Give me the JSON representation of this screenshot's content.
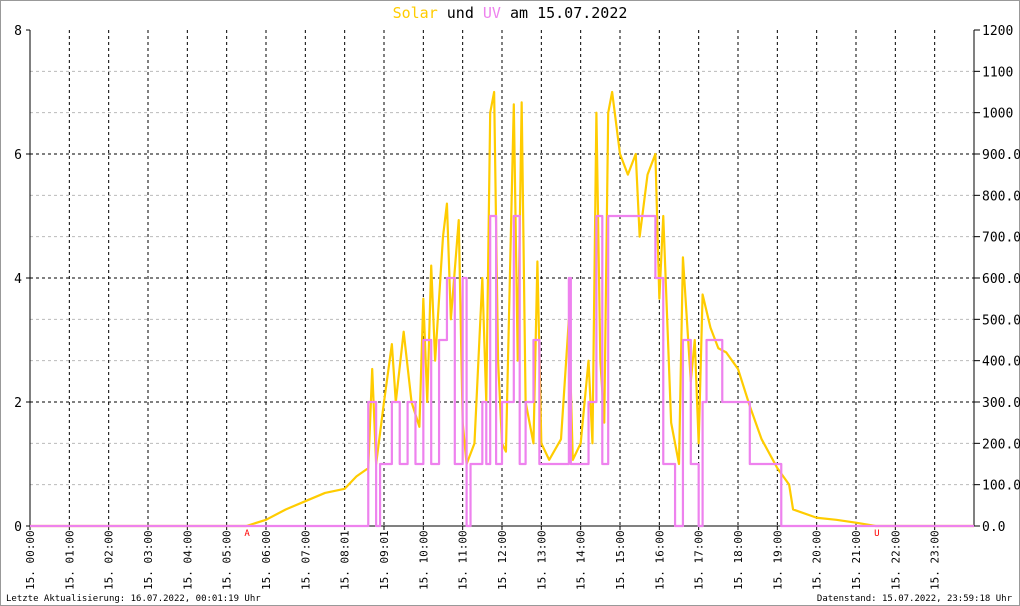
{
  "title": {
    "part1": "Solar",
    "part2": " und ",
    "part3": "UV",
    "part4": " am 15.07.2022"
  },
  "footer": {
    "left": "Letzte Aktualisierung: 16.07.2022, 00:01:19 Uhr",
    "right": "Datenstand: 15.07.2022, 23:59:18 Uhr"
  },
  "colors": {
    "solar": "#ffcc00",
    "uv": "#ee82ee",
    "marker": "#ff0000"
  },
  "chart_data": {
    "type": "line",
    "title": "Solar und UV am 15.07.2022",
    "x_tick_labels": [
      "15. 00:00",
      "15. 01:00",
      "15. 02:00",
      "15. 03:00",
      "15. 04:00",
      "15. 05:00",
      "15. 06:00",
      "15. 07:00",
      "15. 08:01",
      "15. 09:01",
      "15. 10:00",
      "15. 11:00",
      "15. 12:00",
      "15. 13:00",
      "15. 14:00",
      "15. 15:00",
      "15. 16:00",
      "15. 17:00",
      "15. 18:00",
      "15. 19:00",
      "15. 20:00",
      "15. 21:00",
      "15. 22:00",
      "15. 23:00"
    ],
    "xlim": [
      0,
      24
    ],
    "y_left": {
      "ylim": [
        0,
        8
      ],
      "ticks": [
        "0",
        "2",
        "4",
        "6",
        "8"
      ]
    },
    "y_right": {
      "ylim": [
        0,
        1200
      ],
      "ticks": [
        "0.0",
        "100.0",
        "200.0",
        "300.0",
        "400.0",
        "500.0",
        "600.0",
        "700.0",
        "800.0",
        "900.0",
        "1000",
        "1100",
        "1200"
      ]
    },
    "markers": [
      {
        "label": "A",
        "x": 5.52
      },
      {
        "label": "U",
        "x": 21.53
      }
    ],
    "series": [
      {
        "name": "Solar",
        "axis": "right",
        "points": [
          [
            0,
            0
          ],
          [
            5.5,
            0
          ],
          [
            6,
            15
          ],
          [
            6.5,
            40
          ],
          [
            7,
            60
          ],
          [
            7.5,
            80
          ],
          [
            8,
            90
          ],
          [
            8.3,
            120
          ],
          [
            8.6,
            140
          ],
          [
            8.7,
            380
          ],
          [
            8.8,
            150
          ],
          [
            9,
            300
          ],
          [
            9.2,
            440
          ],
          [
            9.3,
            300
          ],
          [
            9.5,
            470
          ],
          [
            9.7,
            300
          ],
          [
            9.9,
            240
          ],
          [
            10,
            550
          ],
          [
            10.1,
            300
          ],
          [
            10.2,
            630
          ],
          [
            10.3,
            400
          ],
          [
            10.5,
            700
          ],
          [
            10.6,
            780
          ],
          [
            10.7,
            500
          ],
          [
            10.9,
            740
          ],
          [
            11,
            250
          ],
          [
            11.1,
            150
          ],
          [
            11.3,
            200
          ],
          [
            11.5,
            600
          ],
          [
            11.6,
            300
          ],
          [
            11.7,
            1000
          ],
          [
            11.8,
            1050
          ],
          [
            11.9,
            400
          ],
          [
            12,
            200
          ],
          [
            12.1,
            180
          ],
          [
            12.3,
            1020
          ],
          [
            12.4,
            400
          ],
          [
            12.5,
            1025
          ],
          [
            12.6,
            300
          ],
          [
            12.8,
            200
          ],
          [
            12.9,
            640
          ],
          [
            13,
            200
          ],
          [
            13.2,
            160
          ],
          [
            13.5,
            210
          ],
          [
            13.7,
            500
          ],
          [
            13.8,
            160
          ],
          [
            14,
            200
          ],
          [
            14.2,
            400
          ],
          [
            14.3,
            200
          ],
          [
            14.4,
            1000
          ],
          [
            14.5,
            400
          ],
          [
            14.6,
            250
          ],
          [
            14.7,
            1000
          ],
          [
            14.8,
            1050
          ],
          [
            15,
            900
          ],
          [
            15.2,
            850
          ],
          [
            15.4,
            900
          ],
          [
            15.5,
            700
          ],
          [
            15.7,
            850
          ],
          [
            15.9,
            900
          ],
          [
            16,
            550
          ],
          [
            16.1,
            750
          ],
          [
            16.3,
            250
          ],
          [
            16.5,
            150
          ],
          [
            16.6,
            650
          ],
          [
            16.8,
            350
          ],
          [
            16.9,
            450
          ],
          [
            17,
            200
          ],
          [
            17.1,
            560
          ],
          [
            17.3,
            480
          ],
          [
            17.5,
            430
          ],
          [
            17.7,
            420
          ],
          [
            18,
            380
          ],
          [
            18.3,
            290
          ],
          [
            18.6,
            210
          ],
          [
            19,
            140
          ],
          [
            19.3,
            100
          ],
          [
            19.4,
            40
          ],
          [
            20,
            20
          ],
          [
            20.5,
            15
          ],
          [
            21,
            8
          ],
          [
            21.5,
            0
          ],
          [
            24,
            0
          ]
        ]
      },
      {
        "name": "UV",
        "axis": "left",
        "step": true,
        "points": [
          [
            0,
            0
          ],
          [
            8.6,
            2
          ],
          [
            8.8,
            0
          ],
          [
            8.9,
            1
          ],
          [
            9.2,
            2
          ],
          [
            9.4,
            1
          ],
          [
            9.6,
            2
          ],
          [
            9.8,
            1
          ],
          [
            10,
            3
          ],
          [
            10.2,
            1
          ],
          [
            10.4,
            3
          ],
          [
            10.6,
            4
          ],
          [
            10.8,
            1
          ],
          [
            11,
            4
          ],
          [
            11.1,
            0
          ],
          [
            11.2,
            1
          ],
          [
            11.5,
            2
          ],
          [
            11.6,
            1
          ],
          [
            11.7,
            5
          ],
          [
            11.85,
            1
          ],
          [
            12,
            2
          ],
          [
            12.3,
            5
          ],
          [
            12.45,
            1
          ],
          [
            12.6,
            2
          ],
          [
            12.8,
            3
          ],
          [
            12.95,
            1
          ],
          [
            13.7,
            4
          ],
          [
            13.75,
            1
          ],
          [
            14.2,
            2
          ],
          [
            14.4,
            5
          ],
          [
            14.55,
            1
          ],
          [
            14.7,
            5
          ],
          [
            15.9,
            4
          ],
          [
            16.1,
            1
          ],
          [
            16.4,
            0
          ],
          [
            16.6,
            3
          ],
          [
            16.8,
            1
          ],
          [
            17,
            0
          ],
          [
            17.1,
            2
          ],
          [
            17.2,
            3
          ],
          [
            17.6,
            2
          ],
          [
            18.3,
            1
          ],
          [
            19.1,
            0
          ],
          [
            24,
            0
          ]
        ]
      }
    ]
  }
}
